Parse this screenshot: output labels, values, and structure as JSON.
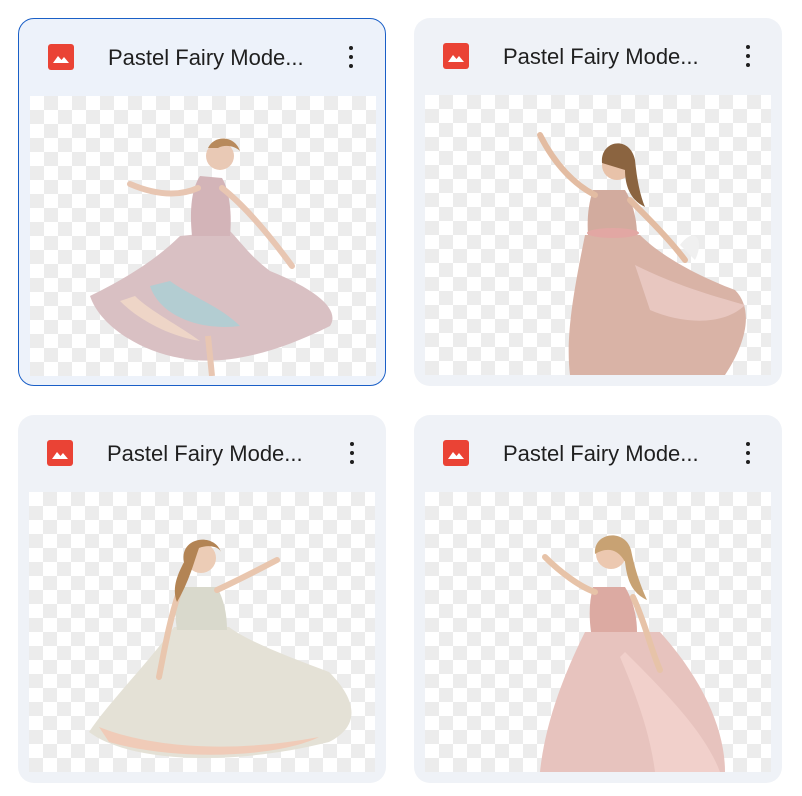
{
  "files": [
    {
      "title": "Pastel Fairy Mode...",
      "type": "image",
      "selected": true,
      "dress": "#d9c0c3",
      "skirt_accent": "#a9cfd6",
      "hair": "#b88a5c"
    },
    {
      "title": "Pastel Fairy Mode...",
      "type": "image",
      "selected": false,
      "dress": "#d9b3a6",
      "skirt_accent": "#e9c9c3",
      "hair": "#8b6440"
    },
    {
      "title": "Pastel Fairy Mode...",
      "type": "image",
      "selected": false,
      "dress": "#e4e1d6",
      "skirt_accent": "#f1c9b5",
      "hair": "#b38454"
    },
    {
      "title": "Pastel Fairy Mode...",
      "type": "image",
      "selected": false,
      "dress": "#e7c3be",
      "skirt_accent": "#f2d1cc",
      "hair": "#c8a273"
    }
  ],
  "icons": {
    "file_type": "image-icon",
    "more": "more-vert-icon"
  },
  "colors": {
    "card_background": "#eff2f7",
    "selected_border": "#1a5fc7",
    "image_icon": "#ea4335"
  }
}
